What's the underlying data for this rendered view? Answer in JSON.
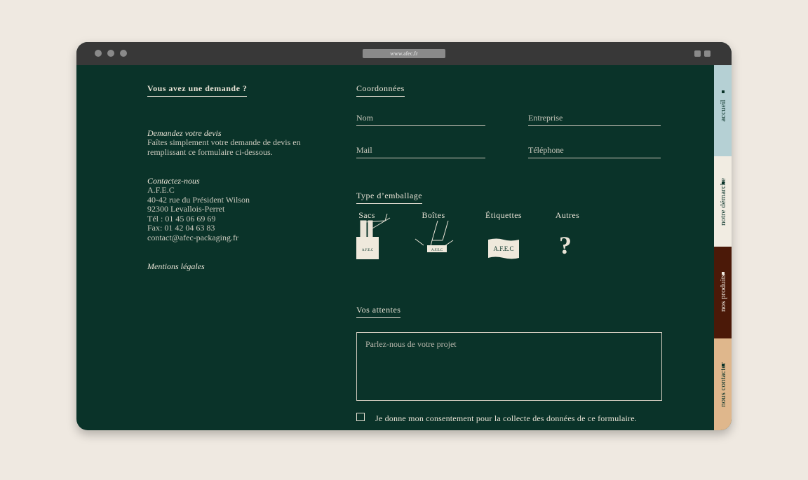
{
  "browser": {
    "url": "www.afec.fr"
  },
  "left": {
    "title": "Vous avez une demande ?",
    "devis_title": "Demandez votre devis",
    "devis_text": [
      "Faîtes simplement votre demande de devis en",
      "remplissant ce formulaire ci-dessous."
    ],
    "contact_title": "Contactez-nous",
    "contact_lines": [
      "A.F.E.C",
      "40-42 rue du Président Wilson",
      "92300 Levallois-Perret",
      "Tél : 01 45 06 69 69",
      "Fax: 01 42 04 63 83",
      "contact@afec-packaging.fr"
    ],
    "mentions": "Mentions légales"
  },
  "form": {
    "coord_title": "Coordonnées",
    "fields": {
      "nom": "Nom",
      "entreprise": "Entreprise",
      "mail": "Mail",
      "telephone": "Téléphone"
    },
    "packaging_title": "Type d’emballage",
    "packaging": [
      {
        "label": "Sacs",
        "icon": "bag-icon",
        "brand": "A.F.E.C"
      },
      {
        "label": "Boîtes",
        "icon": "box-icon",
        "brand": "A.F.E.C"
      },
      {
        "label": "Étiquettes",
        "icon": "label-icon",
        "brand": "A.F.E.C"
      },
      {
        "label": "Autres",
        "icon": "question-icon"
      }
    ],
    "attentes_title": "Vos attentes",
    "attentes_placeholder": "Parlez-nous de votre projet",
    "consent": "Je donne mon consentement pour la collecte des données de ce formulaire."
  },
  "nav": [
    {
      "label": "accueil",
      "bg": "#b5d0d4",
      "fg": "#0a3329"
    },
    {
      "label": "notre démarche",
      "bg": "#f1ece2",
      "fg": "#0a3329"
    },
    {
      "label": "nos produits",
      "bg": "#4b1908",
      "fg": "#f1ece2"
    },
    {
      "label": "nous contacter",
      "bg": "#dfb78c",
      "fg": "#0a3329"
    }
  ]
}
